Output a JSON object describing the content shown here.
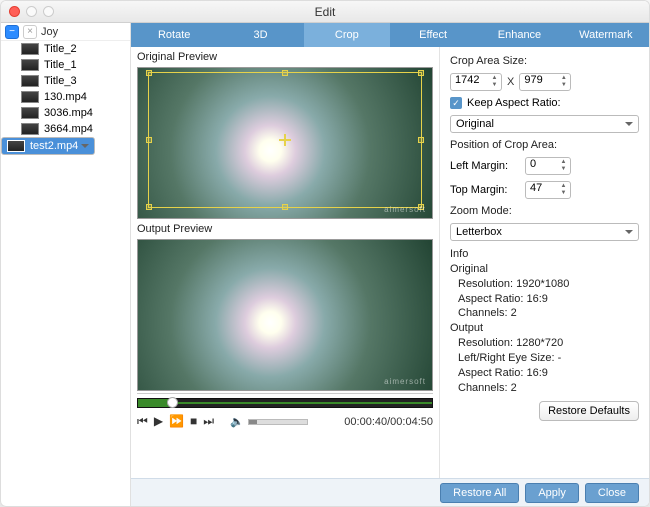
{
  "window": {
    "title": "Edit"
  },
  "sidebar": {
    "header": "Joy",
    "items": [
      {
        "label": "Title_2"
      },
      {
        "label": "Title_1"
      },
      {
        "label": "Title_3"
      },
      {
        "label": "130.mp4"
      },
      {
        "label": "3036.mp4"
      },
      {
        "label": "3664.mp4"
      },
      {
        "label": "test2.mp4",
        "selected": true
      }
    ]
  },
  "tabs": {
    "rotate": "Rotate",
    "three_d": "3D",
    "crop": "Crop",
    "effect": "Effect",
    "enhance": "Enhance",
    "watermark": "Watermark",
    "active": "crop"
  },
  "preview": {
    "original_label": "Original Preview",
    "output_label": "Output Preview",
    "watermark_text": "aimersoft"
  },
  "transport": {
    "time": "00:00:40/00:04:50"
  },
  "crop": {
    "size_label": "Crop Area Size:",
    "width": "1742",
    "height": "979",
    "x_label": "X",
    "keep_aspect_label": "Keep Aspect Ratio:",
    "aspect_value": "Original",
    "position_label": "Position of Crop Area:",
    "left_label": "Left Margin:",
    "left_value": "0",
    "top_label": "Top Margin:",
    "top_value": "47",
    "zoom_label": "Zoom Mode:",
    "zoom_value": "Letterbox"
  },
  "info": {
    "header": "Info",
    "original_header": "Original",
    "original_resolution": "Resolution: 1920*1080",
    "original_aspect": "Aspect Ratio: 16:9",
    "original_channels": "Channels: 2",
    "output_header": "Output",
    "output_resolution": "Resolution: 1280*720",
    "output_eye": "Left/Right Eye Size: -",
    "output_aspect": "Aspect Ratio: 16:9",
    "output_channels": "Channels: 2"
  },
  "buttons": {
    "restore_defaults": "Restore Defaults",
    "restore_all": "Restore All",
    "apply": "Apply",
    "close": "Close"
  }
}
